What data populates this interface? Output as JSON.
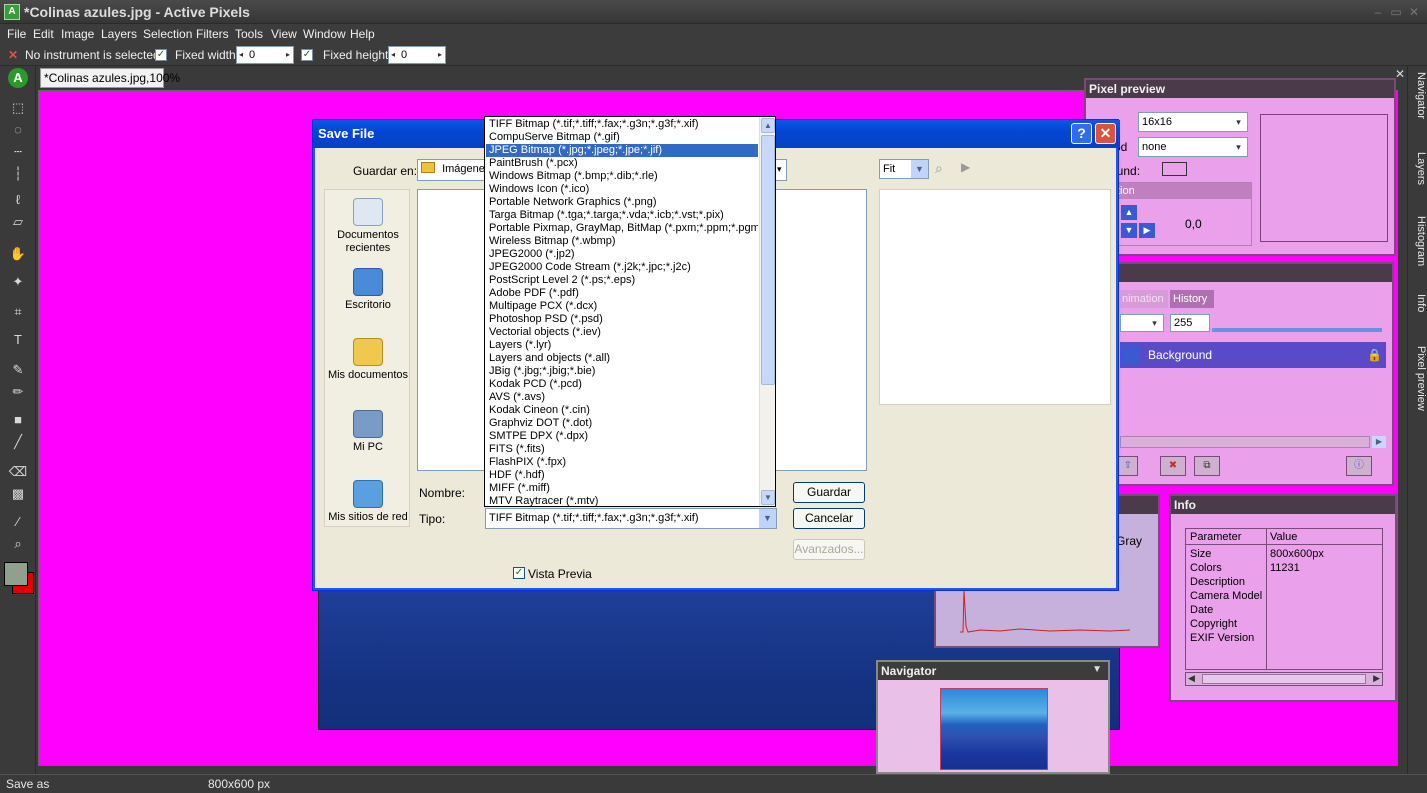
{
  "app": {
    "title": "*Colinas azules.jpg - Active Pixels",
    "icon_glyph": "A",
    "window_controls": [
      "–",
      "▭",
      "✕"
    ]
  },
  "menu": [
    "File",
    "Edit",
    "Image",
    "Layers",
    "Selection",
    "Filters",
    "Tools",
    "View",
    "Window",
    "Help"
  ],
  "options_bar": {
    "instrument_status": "No instrument is selected",
    "fixed_width_label": "Fixed width",
    "fixed_width_value": "0",
    "fixed_height_label": "Fixed height",
    "fixed_height_value": "0"
  },
  "document_tab": "*Colinas azules.jpg,100%",
  "status_bar": {
    "action": "Save as",
    "size": "800x600 px"
  },
  "side_tabs": [
    "Navigator",
    "Layers",
    "Histogram",
    "Info",
    "Pixel preview"
  ],
  "pixel_preview": {
    "title": "Pixel preview",
    "size_value": "16x16",
    "method_label_fragment": "od",
    "method_value": "none",
    "background_label_fragment": "round:",
    "section_fragment": "tion",
    "coords": "0,0"
  },
  "layers_panel": {
    "tab_animation_fragment": "nimation",
    "tab_history": "History",
    "opacity_value": "255",
    "layer_name": "Background"
  },
  "histogram_panel": {
    "mode_fragment": "Gray"
  },
  "info_panel": {
    "title": "Info",
    "headers": [
      "Parameter",
      "Value"
    ],
    "rows": [
      {
        "param": "Size",
        "value": "800x600px"
      },
      {
        "param": "Colors",
        "value": "11231"
      },
      {
        "param": "Description",
        "value": ""
      },
      {
        "param": "Camera Model",
        "value": ""
      },
      {
        "param": "Date",
        "value": ""
      },
      {
        "param": "Copyright",
        "value": ""
      },
      {
        "param": "EXIF Version",
        "value": ""
      }
    ]
  },
  "navigator_panel": {
    "title": "Navigator"
  },
  "save_dialog": {
    "title": "Save File",
    "help_btn": "?",
    "close_btn": "✕",
    "save_in_label": "Guardar en:",
    "save_in_value": "Imágenes",
    "zoom_value": "Fit",
    "places": [
      "Documentos recientes",
      "Escritorio",
      "Mis documentos",
      "Mi PC",
      "Mis sitios de red"
    ],
    "name_label": "Nombre:",
    "type_label": "Tipo:",
    "type_value": "TIFF Bitmap (*.tif;*.tiff;*.fax;*.g3n;*.g3f;*.xif)",
    "save_button": "Guardar",
    "cancel_button": "Cancelar",
    "advanced_button": "Avanzados...",
    "preview_label": "Vista Previa",
    "file_types": [
      "TIFF Bitmap (*.tif;*.tiff;*.fax;*.g3n;*.g3f;*.xif)",
      "CompuServe Bitmap (*.gif)",
      "JPEG Bitmap (*.jpg;*.jpeg;*.jpe;*.jif)",
      "PaintBrush (*.pcx)",
      "Windows Bitmap (*.bmp;*.dib;*.rle)",
      "Windows Icon (*.ico)",
      "Portable Network Graphics (*.png)",
      "Targa Bitmap (*.tga;*.targa;*.vda;*.icb;*.vst;*.pix)",
      "Portable Pixmap, GrayMap, BitMap (*.pxm;*.ppm;*.pgm;*.p",
      "Wireless Bitmap (*.wbmp)",
      "JPEG2000 (*.jp2)",
      "JPEG2000 Code Stream (*.j2k;*.jpc;*.j2c)",
      "PostScript Level 2 (*.ps;*.eps)",
      "Adobe PDF (*.pdf)",
      "Multipage PCX (*.dcx)",
      "Photoshop PSD (*.psd)",
      "Vectorial objects (*.iev)",
      "Layers (*.lyr)",
      "Layers and objects (*.all)",
      "JBig (*.jbg;*.jbig;*.bie)",
      "Kodak PCD (*.pcd)",
      "AVS (*.avs)",
      "Kodak Cineon (*.cin)",
      "Graphviz DOT (*.dot)",
      "SMTPE DPX (*.dpx)",
      "FITS (*.fits)",
      "FlashPIX (*.fpx)",
      "HDF (*.hdf)",
      "MIFF (*.miff)",
      "MTV Raytracer (*.mtv)"
    ],
    "selected_index": 2
  },
  "colors": {
    "canvas_bg": "#ff00ff",
    "panel_bg": "#eaa0ea",
    "xp_blue": "#0447d4",
    "selection": "#316ac5",
    "foreground_swatch": "#8fa08f",
    "background_swatch": "#e00000"
  }
}
